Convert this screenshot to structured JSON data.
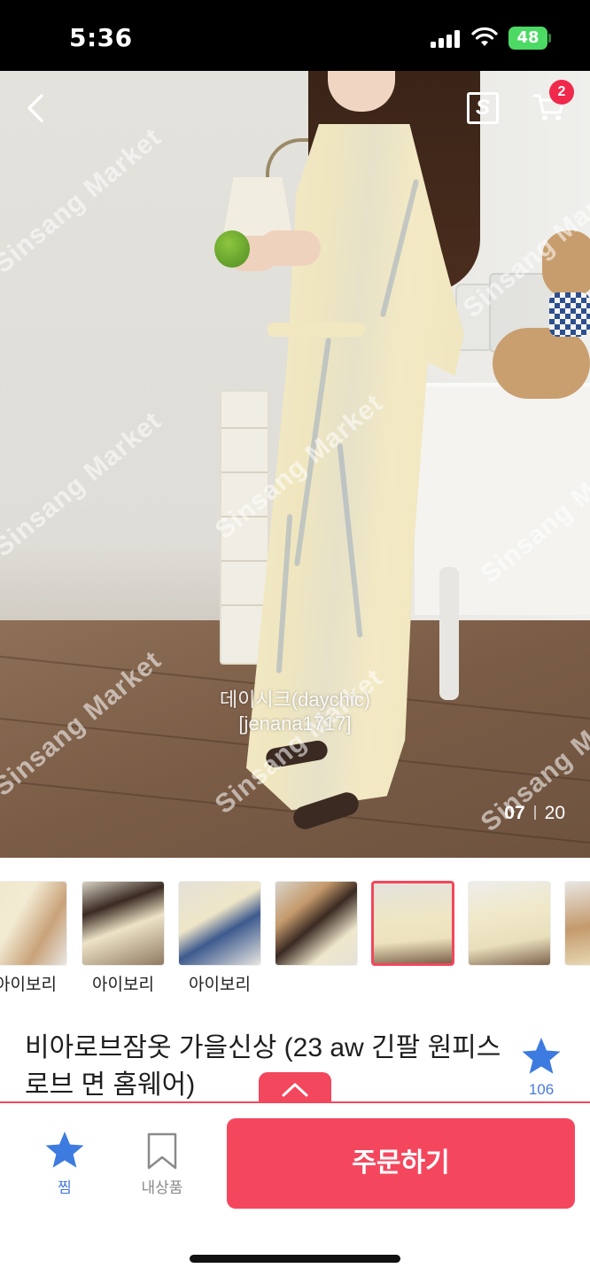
{
  "status_bar": {
    "time": "5:36",
    "battery": "48"
  },
  "header": {
    "back_icon": "chevron-left-icon",
    "brand_icon": "sinsang-s-icon",
    "brand_letter": "S",
    "cart_icon": "cart-icon",
    "cart_count": "2"
  },
  "hero": {
    "watermark_text": "Sinsang Market",
    "caption_line1": "데이시크(daychic)",
    "caption_line2": "[jenana1717]",
    "pager_current": "07",
    "pager_total": "20"
  },
  "thumbnails": [
    {
      "label": "아이보리"
    },
    {
      "label": "아이보리"
    },
    {
      "label": "아이보리"
    },
    {
      "label": ""
    },
    {
      "label": ""
    },
    {
      "label": ""
    },
    {
      "label": ""
    }
  ],
  "selected_thumbnail_index": 4,
  "product": {
    "title": "비아로브잠옷 가을신상 (23 aw 긴팔 원피스 로브 면 홈웨어)",
    "wish_count": "106"
  },
  "bottom_bar": {
    "zzim_label": "찜",
    "mine_label": "내상품",
    "order_label": "주문하기"
  },
  "colors": {
    "accent": "#f4475e",
    "star_blue": "#3d7be0"
  }
}
